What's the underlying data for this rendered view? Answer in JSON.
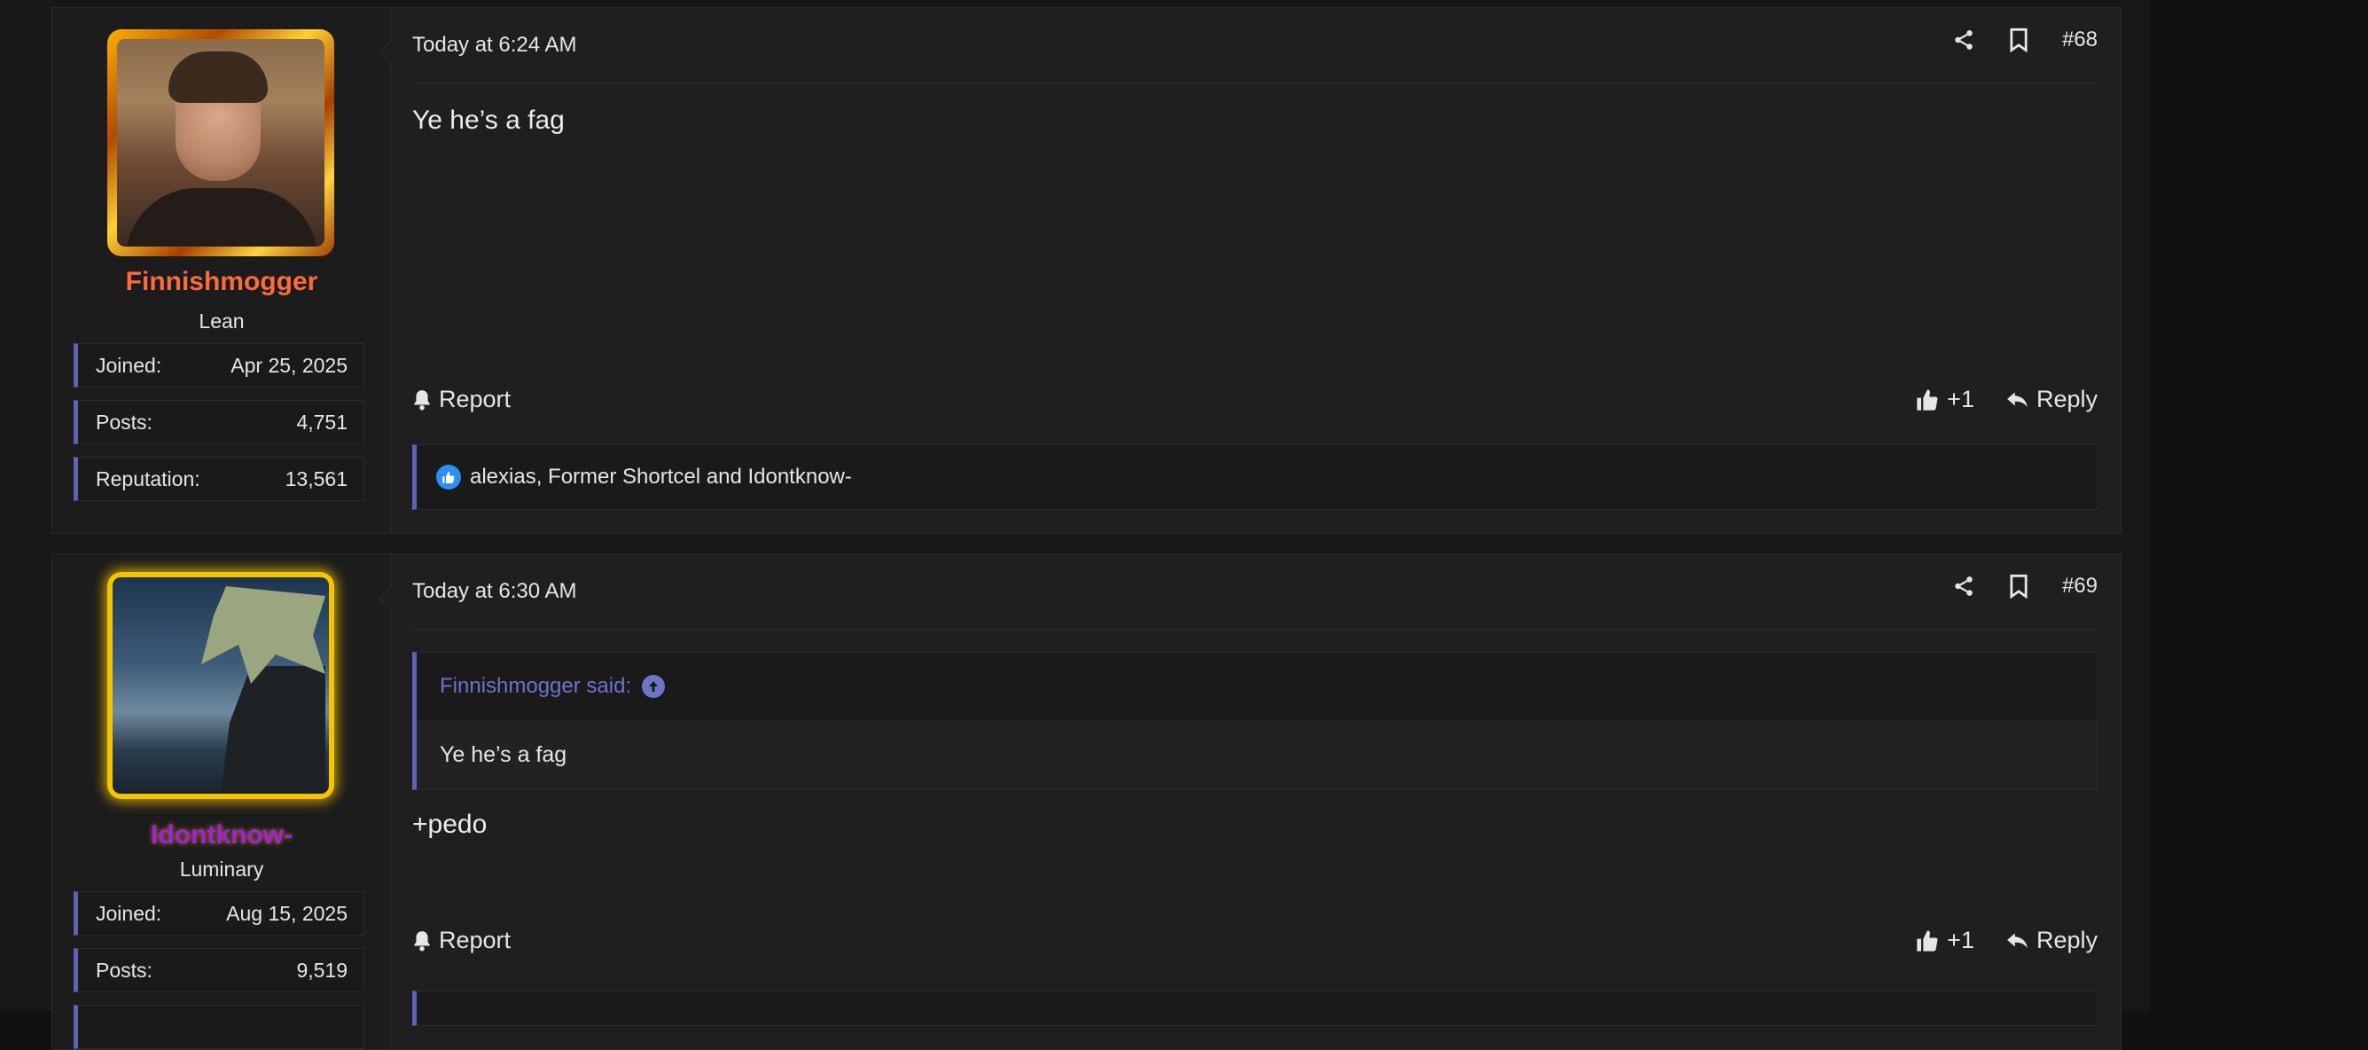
{
  "posts": [
    {
      "author": "Finnishmogger",
      "user_title": "Lean",
      "stats": [
        {
          "label": "Joined:",
          "value": "Apr 25, 2025"
        },
        {
          "label": "Posts:",
          "value": "4,751"
        },
        {
          "label": "Reputation:",
          "value": "13,561"
        }
      ],
      "date": "Today at 6:24 AM",
      "number": "#68",
      "message": "Ye he’s a fag",
      "report_label": "Report",
      "like_count": "+1",
      "reply_label": "Reply",
      "reactions_text": "alexias, Former Shortcel and Idontknow-"
    },
    {
      "author": "Idontknow-",
      "user_title": "Luminary",
      "stats": [
        {
          "label": "Joined:",
          "value": "Aug 15, 2025"
        },
        {
          "label": "Posts:",
          "value": "9,519"
        }
      ],
      "date": "Today at 6:30 AM",
      "number": "#69",
      "quote_author": "Finnishmogger said:",
      "quote_text": "Ye he’s a fag",
      "message": "+pedo",
      "report_label": "Report",
      "like_count": "+1",
      "reply_label": "Reply"
    }
  ],
  "colors": {
    "accent": "#5f63b8",
    "username_orange": "#ff6a3d",
    "username_purple": "#a61ed6",
    "like_blue": "#2d8ef5"
  },
  "icons": [
    "share-icon",
    "bookmark-icon",
    "bell-icon",
    "thumbs-up-icon",
    "reply-icon",
    "like-reaction-icon",
    "up-arrow-icon"
  ]
}
